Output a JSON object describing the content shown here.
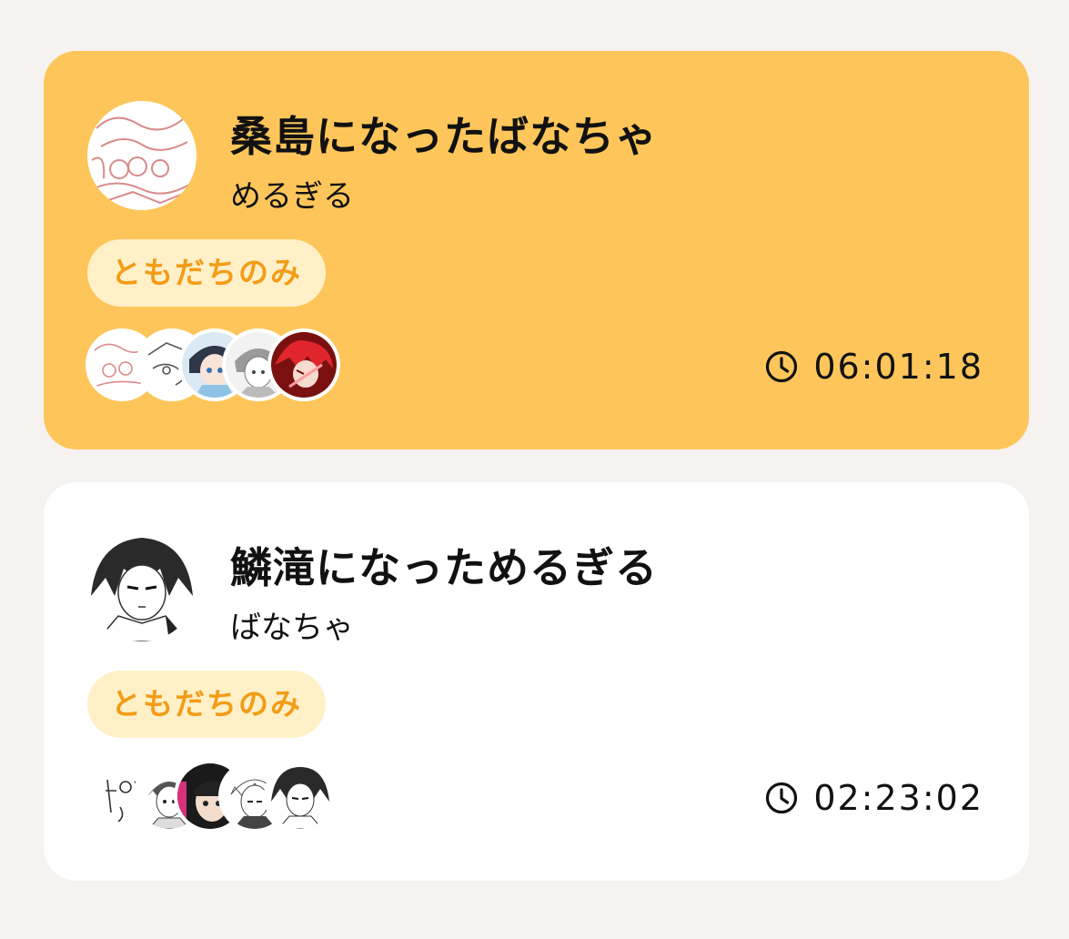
{
  "rooms": [
    {
      "title": "桑島になったばなちゃ",
      "author": "めるぎる",
      "tag": "ともだちのみ",
      "timer": "06:01:18",
      "avatar": "sketch-avatar",
      "members": [
        "sketch-avatar",
        "doodle-avatar",
        "blue-haired-character-avatar",
        "gray-character-avatar",
        "red-haired-character-avatar"
      ],
      "active": true
    },
    {
      "title": "鱗滝になっためるぎる",
      "author": "ばなちゃ",
      "tag": "ともだちのみ",
      "timer": "02:23:02",
      "avatar": "monochrome-manga-avatar",
      "members": [
        "handwritten-doodle-avatar",
        "sketch-character-avatar",
        "dark-haired-character-avatar",
        "white-haired-character-avatar",
        "monochrome-manga-avatar"
      ],
      "active": false
    }
  ],
  "colors": {
    "background": "#f5f2ef",
    "active_card": "#fec65a",
    "card": "#ffffff",
    "tag_bg": "#fff0c8",
    "tag_text": "#f39c16"
  }
}
